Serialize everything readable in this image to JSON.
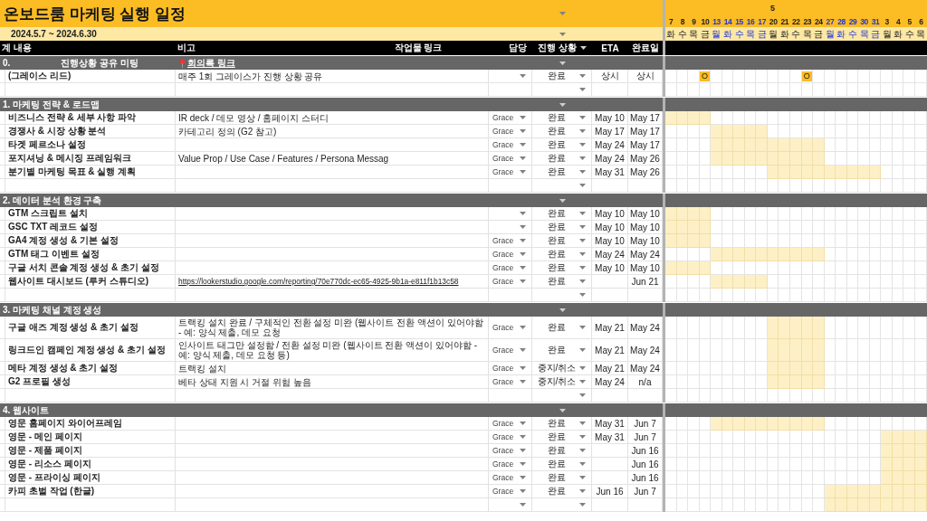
{
  "title": "온보드룸 마케팅 실행 일정",
  "period": "2024.5.7 ~ 2024.6.30",
  "columns": [
    "계 내용",
    "비고",
    "작업물 링크",
    "담당",
    "진행 상황",
    "ETA",
    "완료일"
  ],
  "month": "5",
  "days": [
    {
      "day": "7",
      "weekday": "화",
      "highlight": false
    },
    {
      "day": "8",
      "weekday": "수",
      "highlight": false
    },
    {
      "day": "9",
      "weekday": "목",
      "highlight": false
    },
    {
      "day": "10",
      "weekday": "금",
      "highlight": false
    },
    {
      "day": "13",
      "weekday": "월",
      "highlight": true
    },
    {
      "day": "14",
      "weekday": "화",
      "highlight": true
    },
    {
      "day": "15",
      "weekday": "수",
      "highlight": true
    },
    {
      "day": "16",
      "weekday": "목",
      "highlight": true
    },
    {
      "day": "17",
      "weekday": "금",
      "highlight": true
    },
    {
      "day": "20",
      "weekday": "월",
      "highlight": false
    },
    {
      "day": "21",
      "weekday": "화",
      "highlight": false
    },
    {
      "day": "22",
      "weekday": "수",
      "highlight": false
    },
    {
      "day": "23",
      "weekday": "목",
      "highlight": false
    },
    {
      "day": "24",
      "weekday": "금",
      "highlight": false
    },
    {
      "day": "27",
      "weekday": "월",
      "highlight": true
    },
    {
      "day": "28",
      "weekday": "화",
      "highlight": true
    },
    {
      "day": "29",
      "weekday": "수",
      "highlight": true
    },
    {
      "day": "30",
      "weekday": "목",
      "highlight": true
    },
    {
      "day": "31",
      "weekday": "금",
      "highlight": true
    },
    {
      "day": "3",
      "weekday": "월",
      "highlight": false
    },
    {
      "day": "4",
      "weekday": "화",
      "highlight": false
    },
    {
      "day": "5",
      "weekday": "수",
      "highlight": false
    },
    {
      "day": "6",
      "weekday": "목",
      "highlight": false
    }
  ],
  "sections": [
    {
      "title_parts": [
        "0.",
        "진행상황 공유 미팅"
      ],
      "note_link": "회의록 링크",
      "rows": [
        {
          "kind": "task",
          "task": "(그레이스 리드)",
          "note": "매주 1회 그레이스가 진행 상황 공유",
          "owner_picker": true,
          "status_picker": true,
          "status": "완료",
          "eta": "상시",
          "done": "상시",
          "gantt": [
            false,
            false,
            false,
            "O",
            false,
            false,
            false,
            false,
            false,
            false,
            false,
            false,
            "O",
            false,
            false,
            false,
            false,
            false,
            false,
            false,
            false,
            false,
            false
          ]
        },
        {
          "kind": "empty",
          "owner_picker": false,
          "status_picker": true,
          "gantt": [
            false,
            false,
            false,
            false,
            false,
            false,
            false,
            false,
            false,
            false,
            false,
            false,
            false,
            false,
            false,
            false,
            false,
            false,
            false,
            false,
            false,
            false,
            false
          ]
        }
      ]
    },
    {
      "title_parts": [
        "1. 마케팅 전략 & 로드맵"
      ],
      "rows": [
        {
          "kind": "task",
          "task": "비즈니스 전략 & 세부 사항 파악",
          "note": "IR deck / 데모 영상 / 홈페이지 스터디",
          "owner_picker": true,
          "owner": "Grace",
          "status_picker": true,
          "status": "완료",
          "eta": "May 10",
          "done": "May 17",
          "gantt": [
            true,
            true,
            true,
            true,
            false,
            false,
            false,
            false,
            false,
            false,
            false,
            false,
            false,
            false,
            false,
            false,
            false,
            false,
            false,
            false,
            false,
            false,
            false
          ]
        },
        {
          "kind": "task",
          "task": "경쟁사 & 시장 상황 분석",
          "note": "카테고리 정의 (G2 참고)",
          "owner_picker": true,
          "owner": "Grace",
          "status_picker": true,
          "status": "완료",
          "eta": "May 17",
          "done": "May 17",
          "gantt": [
            false,
            false,
            false,
            false,
            true,
            true,
            true,
            true,
            true,
            false,
            false,
            false,
            false,
            false,
            false,
            false,
            false,
            false,
            false,
            false,
            false,
            false,
            false
          ]
        },
        {
          "kind": "task",
          "task": "타겟 페르소나 설정",
          "owner_picker": true,
          "owner": "Grace",
          "status_picker": true,
          "status": "완료",
          "eta": "May 24",
          "done": "May 17",
          "gantt": [
            false,
            false,
            false,
            false,
            true,
            true,
            true,
            true,
            true,
            true,
            true,
            true,
            true,
            true,
            false,
            false,
            false,
            false,
            false,
            false,
            false,
            false,
            false
          ]
        },
        {
          "kind": "task",
          "task": "포지셔닝 & 메시징 프레임워크",
          "note": "Value Prop / Use Case / Features / Persona Messag",
          "owner_picker": true,
          "owner": "Grace",
          "status_picker": true,
          "status": "완료",
          "eta": "May 24",
          "done": "May 26",
          "gantt": [
            false,
            false,
            false,
            false,
            true,
            true,
            true,
            true,
            true,
            true,
            true,
            true,
            true,
            true,
            false,
            false,
            false,
            false,
            false,
            false,
            false,
            false,
            false
          ]
        },
        {
          "kind": "task",
          "task": "분기별 마케팅 목표 & 실행 계획",
          "owner_picker": true,
          "owner": "Grace",
          "status_picker": true,
          "status": "완료",
          "eta": "May 31",
          "done": "May 26",
          "gantt": [
            false,
            false,
            false,
            false,
            false,
            false,
            false,
            false,
            false,
            true,
            true,
            true,
            true,
            true,
            true,
            true,
            true,
            true,
            true,
            false,
            false,
            false,
            false
          ]
        },
        {
          "kind": "empty",
          "owner_picker": false,
          "status_picker": true,
          "gantt": [
            false,
            false,
            false,
            false,
            false,
            false,
            false,
            false,
            false,
            false,
            false,
            false,
            false,
            false,
            false,
            false,
            false,
            false,
            false,
            false,
            false,
            false,
            false
          ]
        }
      ]
    },
    {
      "title_parts": [
        "2. 데이터 분석 환경 구축"
      ],
      "rows": [
        {
          "kind": "task",
          "task": "GTM 스크립트 설치",
          "owner_picker": true,
          "status_picker": true,
          "status": "완료",
          "eta": "May 10",
          "done": "May 10",
          "gantt": [
            true,
            true,
            true,
            true,
            false,
            false,
            false,
            false,
            false,
            false,
            false,
            false,
            false,
            false,
            false,
            false,
            false,
            false,
            false,
            false,
            false,
            false,
            false
          ]
        },
        {
          "kind": "task",
          "task": "GSC TXT 레코드 설정",
          "owner_picker": true,
          "status_picker": true,
          "status": "완료",
          "eta": "May 10",
          "done": "May 10",
          "gantt": [
            true,
            true,
            true,
            true,
            false,
            false,
            false,
            false,
            false,
            false,
            false,
            false,
            false,
            false,
            false,
            false,
            false,
            false,
            false,
            false,
            false,
            false,
            false
          ]
        },
        {
          "kind": "task",
          "task": "GA4 계정 생성 & 기본 설정",
          "owner_picker": true,
          "owner": "Grace",
          "status_picker": true,
          "status": "완료",
          "eta": "May 10",
          "done": "May 10",
          "gantt": [
            true,
            true,
            true,
            true,
            false,
            false,
            false,
            false,
            false,
            false,
            false,
            false,
            false,
            false,
            false,
            false,
            false,
            false,
            false,
            false,
            false,
            false,
            false
          ]
        },
        {
          "kind": "task",
          "task": "GTM 태그 이벤트 설정",
          "owner_picker": true,
          "owner": "Grace",
          "status_picker": true,
          "status": "완료",
          "eta": "May 24",
          "done": "May 24",
          "gantt": [
            false,
            false,
            false,
            false,
            true,
            true,
            true,
            true,
            true,
            true,
            true,
            true,
            true,
            true,
            false,
            false,
            false,
            false,
            false,
            false,
            false,
            false,
            false
          ]
        },
        {
          "kind": "task",
          "task": "구글 서치 콘솔 계정 생성 & 초기 설정",
          "owner_picker": true,
          "owner": "Grace",
          "status_picker": true,
          "status": "완료",
          "eta": "May 10",
          "done": "May 10",
          "gantt": [
            true,
            true,
            true,
            true,
            false,
            false,
            false,
            false,
            false,
            false,
            false,
            false,
            false,
            false,
            false,
            false,
            false,
            false,
            false,
            false,
            false,
            false,
            false
          ]
        },
        {
          "kind": "task",
          "task": "웹사이트 대시보드 (루커 스튜디오)",
          "note_url": "https://lookerstudio.google.com/reporting/70e770dc-ec65-4925-9b1a-e811f1b13c58",
          "owner_picker": true,
          "owner": "Grace",
          "status_picker": true,
          "status": "완료",
          "done": "Jun 21",
          "gantt": [
            false,
            false,
            false,
            false,
            true,
            true,
            true,
            true,
            true,
            false,
            false,
            false,
            false,
            false,
            false,
            false,
            false,
            false,
            false,
            false,
            false,
            false,
            false
          ]
        },
        {
          "kind": "empty",
          "owner_picker": false,
          "status_picker": true,
          "gantt": [
            false,
            false,
            false,
            false,
            false,
            false,
            false,
            false,
            false,
            false,
            false,
            false,
            false,
            false,
            false,
            false,
            false,
            false,
            false,
            false,
            false,
            false,
            false
          ]
        }
      ]
    },
    {
      "title_parts": [
        "3. 마케팅 채널 계정 생성"
      ],
      "rows": [
        {
          "kind": "task",
          "task": "구글 애즈 계정 생성 & 초기 설정",
          "note": "트랙킹 설치 완료 / 구체적인 전환 설정 미완 (웹사이트 전환 액션이 있어야함 - 예: 양식 제출, 데모 요청",
          "owner_picker": true,
          "owner": "Grace",
          "status_picker": true,
          "status": "완료",
          "eta": "May 21",
          "done": "May 24",
          "gantt": [
            false,
            false,
            false,
            false,
            false,
            false,
            false,
            false,
            false,
            true,
            true,
            true,
            true,
            true,
            false,
            false,
            false,
            false,
            false,
            false,
            false,
            false,
            false
          ]
        },
        {
          "kind": "task",
          "task": "링크드인 캠페인 계정 생성 & 초기 설정",
          "note": "인사이트 태그만 설정함 / 전환 설정 미완 (웹사이트 전환 액션이 있어야함 - 예: 양식 제출, 데모 요청 등)",
          "owner_picker": true,
          "owner": "Grace",
          "status_picker": true,
          "status": "완료",
          "eta": "May 21",
          "done": "May 24",
          "gantt": [
            false,
            false,
            false,
            false,
            false,
            false,
            false,
            false,
            false,
            true,
            true,
            true,
            true,
            true,
            false,
            false,
            false,
            false,
            false,
            false,
            false,
            false,
            false
          ]
        },
        {
          "kind": "task",
          "task": "메타 계정 생성 & 초기 설정",
          "note": "트랙킹 설치",
          "owner_picker": true,
          "owner": "Grace",
          "status_picker": true,
          "status": "중지/취소",
          "eta": "May 21",
          "done": "May 24",
          "gantt": [
            false,
            false,
            false,
            false,
            false,
            false,
            false,
            false,
            false,
            true,
            true,
            true,
            true,
            true,
            false,
            false,
            false,
            false,
            false,
            false,
            false,
            false,
            false
          ]
        },
        {
          "kind": "task",
          "task": "G2 프로필 생성",
          "note": "베타 상태 지원 시 거절 위험 높음",
          "owner_picker": true,
          "owner": "Grace",
          "status_picker": true,
          "status": "중지/취소",
          "eta": "May 24",
          "done": "n/a",
          "gantt": [
            false,
            false,
            false,
            false,
            false,
            false,
            false,
            false,
            false,
            true,
            true,
            true,
            true,
            true,
            false,
            false,
            false,
            false,
            false,
            false,
            false,
            false,
            false
          ]
        },
        {
          "kind": "empty",
          "owner_picker": false,
          "status_picker": true,
          "gantt": [
            false,
            false,
            false,
            false,
            false,
            false,
            false,
            false,
            false,
            false,
            false,
            false,
            false,
            false,
            false,
            false,
            false,
            false,
            false,
            false,
            false,
            false,
            false
          ]
        }
      ]
    },
    {
      "title_parts": [
        "4. 웹사이트"
      ],
      "rows": [
        {
          "kind": "task",
          "task": "영문 홈페이지 와이어프레임",
          "owner_picker": true,
          "owner": "Grace",
          "status_picker": true,
          "status": "완료",
          "eta": "May 31",
          "done": "Jun 7",
          "gantt": [
            false,
            false,
            false,
            false,
            true,
            true,
            true,
            true,
            true,
            true,
            true,
            true,
            true,
            true,
            false,
            false,
            false,
            false,
            false,
            false,
            false,
            false,
            false
          ]
        },
        {
          "kind": "task",
          "task": "영문 - 메인 페이지",
          "owner_picker": true,
          "owner": "Grace",
          "status_picker": true,
          "status": "완료",
          "eta": "May 31",
          "done": "Jun 7",
          "gantt": [
            false,
            false,
            false,
            false,
            false,
            false,
            false,
            false,
            false,
            false,
            false,
            false,
            false,
            false,
            false,
            false,
            false,
            false,
            false,
            true,
            true,
            true,
            true
          ]
        },
        {
          "kind": "task",
          "task": "영문 - 제품 페이지",
          "owner_picker": true,
          "owner": "Grace",
          "status_picker": true,
          "status": "완료",
          "done": "Jun 16",
          "gantt": [
            false,
            false,
            false,
            false,
            false,
            false,
            false,
            false,
            false,
            false,
            false,
            false,
            false,
            false,
            false,
            false,
            false,
            false,
            false,
            true,
            true,
            true,
            true
          ]
        },
        {
          "kind": "task",
          "task": "영문 - 리소스 페이지",
          "owner_picker": true,
          "owner": "Grace",
          "status_picker": true,
          "status": "완료",
          "done": "Jun 16",
          "gantt": [
            false,
            false,
            false,
            false,
            false,
            false,
            false,
            false,
            false,
            false,
            false,
            false,
            false,
            false,
            false,
            false,
            false,
            false,
            false,
            true,
            true,
            true,
            true
          ]
        },
        {
          "kind": "task",
          "task": "영문 - 프라이싱 페이지",
          "owner_picker": true,
          "owner": "Grace",
          "status_picker": true,
          "status": "완료",
          "done": "Jun 16",
          "gantt": [
            false,
            false,
            false,
            false,
            false,
            false,
            false,
            false,
            false,
            false,
            false,
            false,
            false,
            false,
            false,
            false,
            false,
            false,
            false,
            true,
            true,
            true,
            true
          ]
        },
        {
          "kind": "task",
          "task": "카피 초벌 작업 (한글)",
          "owner_picker": true,
          "owner": "Grace",
          "status_picker": true,
          "status": "완료",
          "eta": "Jun 16",
          "done": "Jun 7",
          "gantt": [
            false,
            false,
            false,
            false,
            false,
            false,
            false,
            false,
            false,
            false,
            false,
            false,
            false,
            false,
            true,
            true,
            true,
            true,
            true,
            true,
            true,
            true,
            true
          ]
        },
        {
          "kind": "empty",
          "owner_picker": true,
          "status_picker": true,
          "gantt": [
            false,
            false,
            false,
            false,
            false,
            false,
            false,
            false,
            false,
            false,
            false,
            false,
            false,
            false,
            true,
            true,
            true,
            true,
            true,
            true,
            true,
            true,
            true
          ]
        }
      ]
    }
  ]
}
